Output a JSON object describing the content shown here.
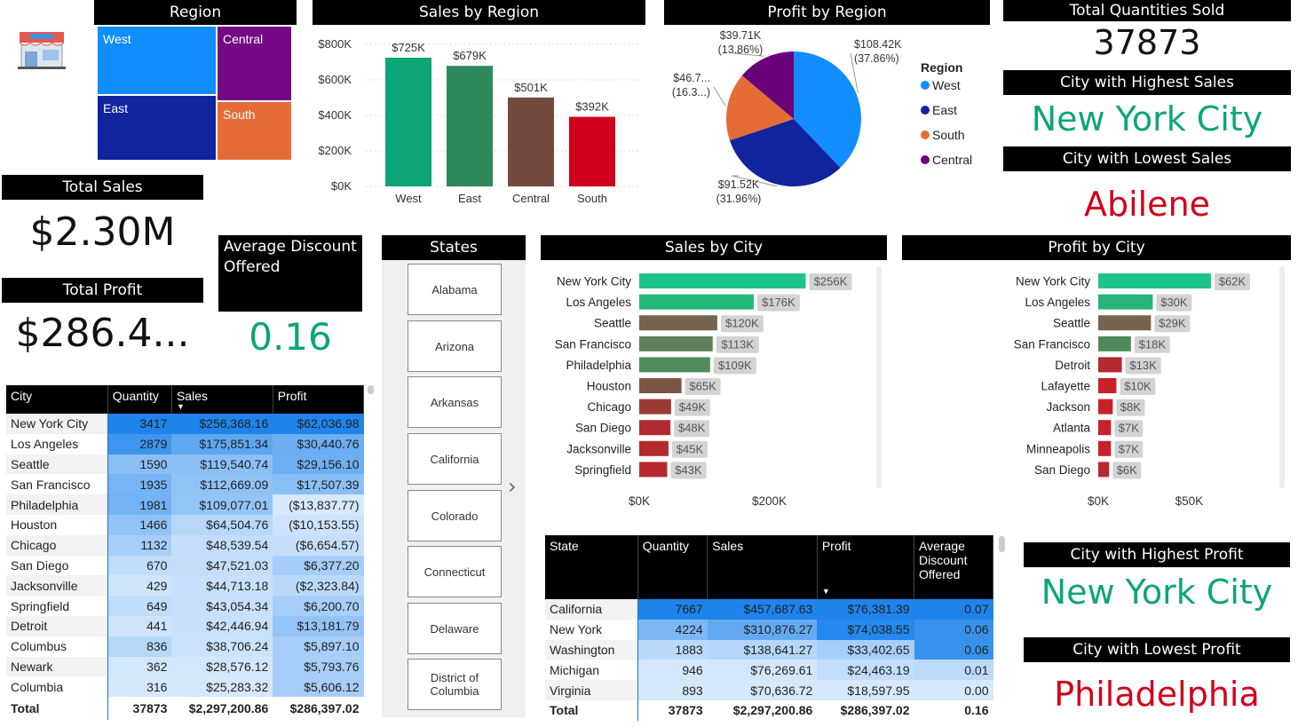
{
  "region_panel": {
    "title": "Region",
    "icon": "store-icon",
    "treemap": [
      {
        "label": "West",
        "color": "#118dff"
      },
      {
        "label": "Central",
        "color": "#750985"
      },
      {
        "label": "East",
        "color": "#12239e"
      },
      {
        "label": "South",
        "color": "#e66c37"
      }
    ]
  },
  "sales_by_region": {
    "title": "Sales by Region",
    "chart_data": {
      "type": "bar",
      "categories": [
        "West",
        "East",
        "Central",
        "South"
      ],
      "values": [
        725,
        679,
        501,
        392
      ],
      "data_labels": [
        "$725K",
        "$679K",
        "$501K",
        "$392K"
      ],
      "colors": [
        "#0da577",
        "#2e8a5c",
        "#744a3f",
        "#d0021b"
      ],
      "yticks": [
        "$0K",
        "$200K",
        "$400K",
        "$600K",
        "$800K"
      ],
      "ylim": [
        0,
        800
      ]
    }
  },
  "profit_by_region": {
    "title": "Profit by Region",
    "legend_title": "Region",
    "chart_data": {
      "type": "pie",
      "slices": [
        {
          "name": "West",
          "value": 108.42,
          "label": "$108.42K",
          "pct": "(37.86%)",
          "color": "#118dff"
        },
        {
          "name": "East",
          "value": 91.52,
          "label": "$91.52K",
          "pct": "(31.96%)",
          "color": "#12239e"
        },
        {
          "name": "South",
          "value": 46.7,
          "label": "$46.7...",
          "pct": "(16.3...)",
          "color": "#e66c37"
        },
        {
          "name": "Central",
          "value": 39.71,
          "label": "$39.71K",
          "pct": "(13.86%)",
          "color": "#6b007b"
        }
      ]
    }
  },
  "kpis": {
    "total_quantities_title": "Total Quantities Sold",
    "total_quantities_value": "37873",
    "highest_sales_city_title": "City with Highest Sales",
    "highest_sales_city": "New York City",
    "lowest_sales_city_title": "City with Lowest Sales",
    "lowest_sales_city": "Abilene",
    "total_sales_title": "Total Sales",
    "total_sales_value": "$2.30M",
    "total_profit_title": "Total Profit",
    "total_profit_value": "$286.4...",
    "avg_discount_title": "Average Discount Offered",
    "avg_discount_value": "0.16",
    "highest_profit_city_title": "City with Highest Profit",
    "highest_profit_city": "New York City",
    "lowest_profit_city_title": "City with Lowest Profit",
    "lowest_profit_city": "Philadelphia",
    "green": "#0da577",
    "red": "#d0021b"
  },
  "states_slicer": {
    "title": "States",
    "items": [
      "Alabama",
      "Arizona",
      "Arkansas",
      "California",
      "Colorado",
      "Connecticut",
      "Delaware",
      "District of Columbia"
    ]
  },
  "sales_by_city": {
    "title": "Sales by City",
    "chart_data": {
      "type": "bar",
      "orientation": "horizontal",
      "categories": [
        "New York City",
        "Los Angeles",
        "Seattle",
        "San Francisco",
        "Philadelphia",
        "Houston",
        "Chicago",
        "San Diego",
        "Jacksonville",
        "Springfield"
      ],
      "values": [
        256,
        176,
        120,
        113,
        109,
        65,
        49,
        48,
        45,
        43
      ],
      "data_labels": [
        "$256K",
        "$176K",
        "$120K",
        "$113K",
        "$109K",
        "$65K",
        "$49K",
        "$48K",
        "$45K",
        "$43K"
      ],
      "colors": [
        "#1ec38a",
        "#22b877",
        "#776450",
        "#5f7f5c",
        "#4f8b5c",
        "#7a5547",
        "#9c3b35",
        "#b22a2f",
        "#b52a2f",
        "#b8292f"
      ],
      "xticks": [
        "$0K",
        "$200K"
      ],
      "xlim": [
        0,
        370
      ]
    }
  },
  "profit_by_city": {
    "title": "Profit by City",
    "chart_data": {
      "type": "bar",
      "orientation": "horizontal",
      "categories": [
        "New York City",
        "Los Angeles",
        "Seattle",
        "San Francisco",
        "Detroit",
        "Lafayette",
        "Jackson",
        "Atlanta",
        "Minneapolis",
        "San Diego"
      ],
      "values": [
        62,
        30,
        29,
        18,
        13,
        10,
        8,
        7,
        7,
        6
      ],
      "data_labels": [
        "$62K",
        "$30K",
        "$29K",
        "$18K",
        "$13K",
        "$10K",
        "$8K",
        "$7K",
        "$7K",
        "$6K"
      ],
      "colors": [
        "#1ec38a",
        "#28b37a",
        "#776450",
        "#4f8b5c",
        "#b52a2f",
        "#c8202b",
        "#c8202b",
        "#c8202b",
        "#c8202b",
        "#b8292f"
      ],
      "xticks": [
        "$0K",
        "$50K"
      ],
      "xlim": [
        0,
        85
      ]
    }
  },
  "city_table": {
    "columns": [
      "City",
      "Quantity",
      "Sales",
      "Profit"
    ],
    "rows": [
      [
        "New York City",
        "3417",
        "$256,368.16",
        "$62,036.98"
      ],
      [
        "Los Angeles",
        "2879",
        "$175,851.34",
        "$30,440.76"
      ],
      [
        "Seattle",
        "1590",
        "$119,540.74",
        "$29,156.10"
      ],
      [
        "San Francisco",
        "1935",
        "$112,669.09",
        "$17,507.39"
      ],
      [
        "Philadelphia",
        "1981",
        "$109,077.01",
        "($13,837.77)"
      ],
      [
        "Houston",
        "1466",
        "$64,504.76",
        "($10,153.55)"
      ],
      [
        "Chicago",
        "1132",
        "$48,539.54",
        "($6,654.57)"
      ],
      [
        "San Diego",
        "670",
        "$47,521.03",
        "$6,377.20"
      ],
      [
        "Jacksonville",
        "429",
        "$44,713.18",
        "($2,323.84)"
      ],
      [
        "Springfield",
        "649",
        "$43,054.34",
        "$6,200.70"
      ],
      [
        "Detroit",
        "441",
        "$42,446.94",
        "$13,181.79"
      ],
      [
        "Columbus",
        "836",
        "$38,706.24",
        "$5,897.10"
      ],
      [
        "Newark",
        "362",
        "$28,576.12",
        "$5,793.76"
      ],
      [
        "Columbia",
        "316",
        "$25,283.32",
        "$5,606.12"
      ]
    ],
    "total": [
      "Total",
      "37873",
      "$2,297,200.86",
      "$286,397.02"
    ]
  },
  "state_table": {
    "columns": [
      "State",
      "Quantity",
      "Sales",
      "Profit",
      "Average Discount Offered"
    ],
    "rows": [
      [
        "California",
        "7667",
        "$457,687.63",
        "$76,381.39",
        "0.07"
      ],
      [
        "New York",
        "4224",
        "$310,876.27",
        "$74,038.55",
        "0.06"
      ],
      [
        "Washington",
        "1883",
        "$138,641.27",
        "$33,402.65",
        "0.06"
      ],
      [
        "Michigan",
        "946",
        "$76,269.61",
        "$24,463.19",
        "0.01"
      ],
      [
        "Virginia",
        "893",
        "$70,636.72",
        "$18,597.95",
        "0.00"
      ]
    ],
    "total": [
      "Total",
      "37873",
      "$2,297,200.86",
      "$286,397.02",
      "0.16"
    ]
  }
}
